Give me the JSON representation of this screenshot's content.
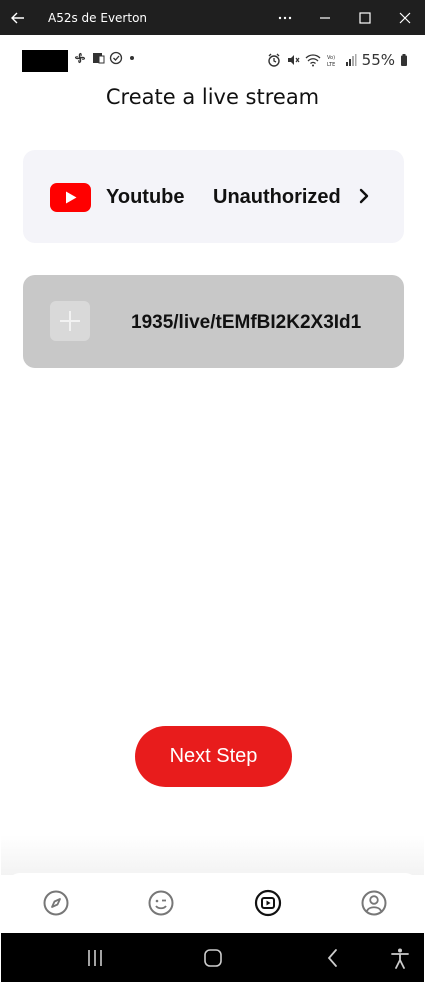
{
  "window": {
    "title": "A52s de Everton"
  },
  "status_bar": {
    "battery": "55%"
  },
  "page": {
    "title": "Create a live stream"
  },
  "youtube_card": {
    "platform": "Youtube",
    "status": "Unauthorized"
  },
  "rtmp_card": {
    "url": "1935/live/tEMfBI2K2X3Id1"
  },
  "actions": {
    "next_step": "Next Step"
  },
  "colors": {
    "accent": "#e81c1c",
    "youtube_red": "#ff0000",
    "card_bg": "#f4f4f9",
    "disabled_card_bg": "#c8c8c8"
  },
  "icons": {
    "title_bar": [
      "back-arrow-icon",
      "more-icon",
      "minimize-icon",
      "maximize-icon",
      "close-icon"
    ],
    "bottom_nav": [
      "compass-icon",
      "face-icon",
      "live-icon",
      "profile-icon"
    ],
    "android_nav": [
      "recents-icon",
      "home-icon",
      "back-icon",
      "accessibility-icon"
    ]
  }
}
